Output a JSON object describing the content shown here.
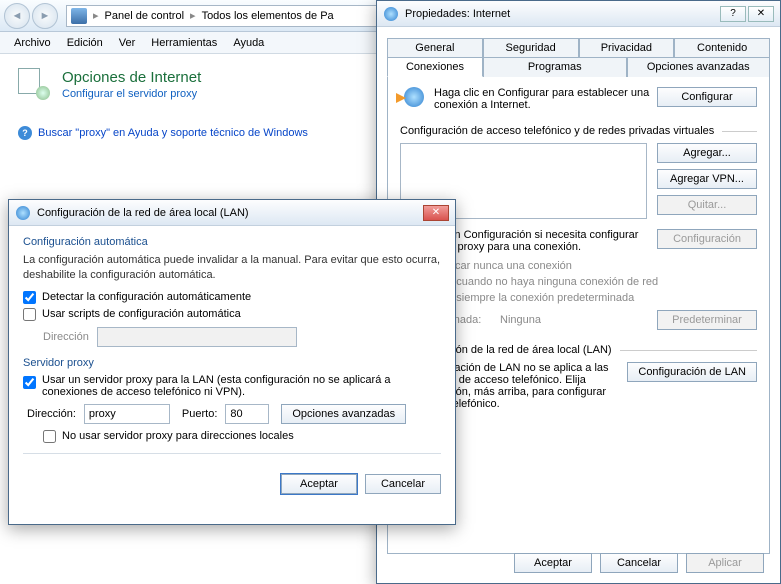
{
  "explorer": {
    "segment1": "Panel de control",
    "segment2": "Todos los elementos de Pa"
  },
  "menu": {
    "archivo": "Archivo",
    "edicion": "Edición",
    "ver": "Ver",
    "herramientas": "Herramientas",
    "ayuda": "Ayuda"
  },
  "page": {
    "heading": "Opciones de Internet",
    "subhead": "Configurar el servidor proxy",
    "search_link": "Buscar \"proxy\" en Ayuda y soporte técnico de Windows"
  },
  "inetprop": {
    "title": "Propiedades: Internet",
    "tabs_top": [
      "General",
      "Seguridad",
      "Privacidad",
      "Contenido"
    ],
    "tabs_bot": [
      "Conexiones",
      "Programas",
      "Opciones avanzadas"
    ],
    "setup_text": "Haga clic en Configurar para establecer una conexión a Internet.",
    "btn_configurar": "Configurar",
    "dial_section": "Configuración de acceso telefónico y de redes privadas virtuales",
    "btn_agregar": "Agregar...",
    "btn_agregar_vpn": "Agregar VPN...",
    "btn_quitar": "Quitar...",
    "dial_hint": "Haga clic en Configuración si necesita configurar un servidor proxy para una conexión.",
    "btn_config": "Configuración",
    "radio1": "No marcar nunca una conexión",
    "radio2": "Marcar cuando no haya ninguna conexión de red",
    "radio3": "Marcar siempre la conexión predeterminada",
    "pred_label": "Predeterminada:",
    "pred_value": "Ninguna",
    "btn_predet": "Predeterminar",
    "lan_section": "Configuración de la red de área local (LAN)",
    "lan_hint": "La configuración de LAN no se aplica a las conexiones de acceso telefónico. Elija Configuración, más arriba, para configurar el acceso telefónico.",
    "btn_lan": "Configuración de LAN",
    "btn_aceptar": "Aceptar",
    "btn_cancelar": "Cancelar",
    "btn_aplicar": "Aplicar"
  },
  "lan": {
    "title": "Configuración de la red de área local (LAN)",
    "auto_title": "Configuración automática",
    "auto_desc": "La configuración automática puede invalidar a la manual. Para evitar que esto ocurra, deshabilite la configuración automática.",
    "chk_detect": "Detectar la configuración automáticamente",
    "chk_script": "Usar scripts de configuración automática",
    "lbl_direccion": "Dirección",
    "proxy_title": "Servidor proxy",
    "chk_proxy": "Usar un servidor proxy para la LAN (esta configuración no se aplicará a conexiones de acceso telefónico ni VPN).",
    "lbl_addr": "Dirección:",
    "val_addr": "proxy",
    "lbl_port": "Puerto:",
    "val_port": "80",
    "btn_adv": "Opciones avanzadas",
    "chk_bypass": "No usar servidor proxy para direcciones locales",
    "btn_ok": "Aceptar",
    "btn_cancel": "Cancelar"
  }
}
